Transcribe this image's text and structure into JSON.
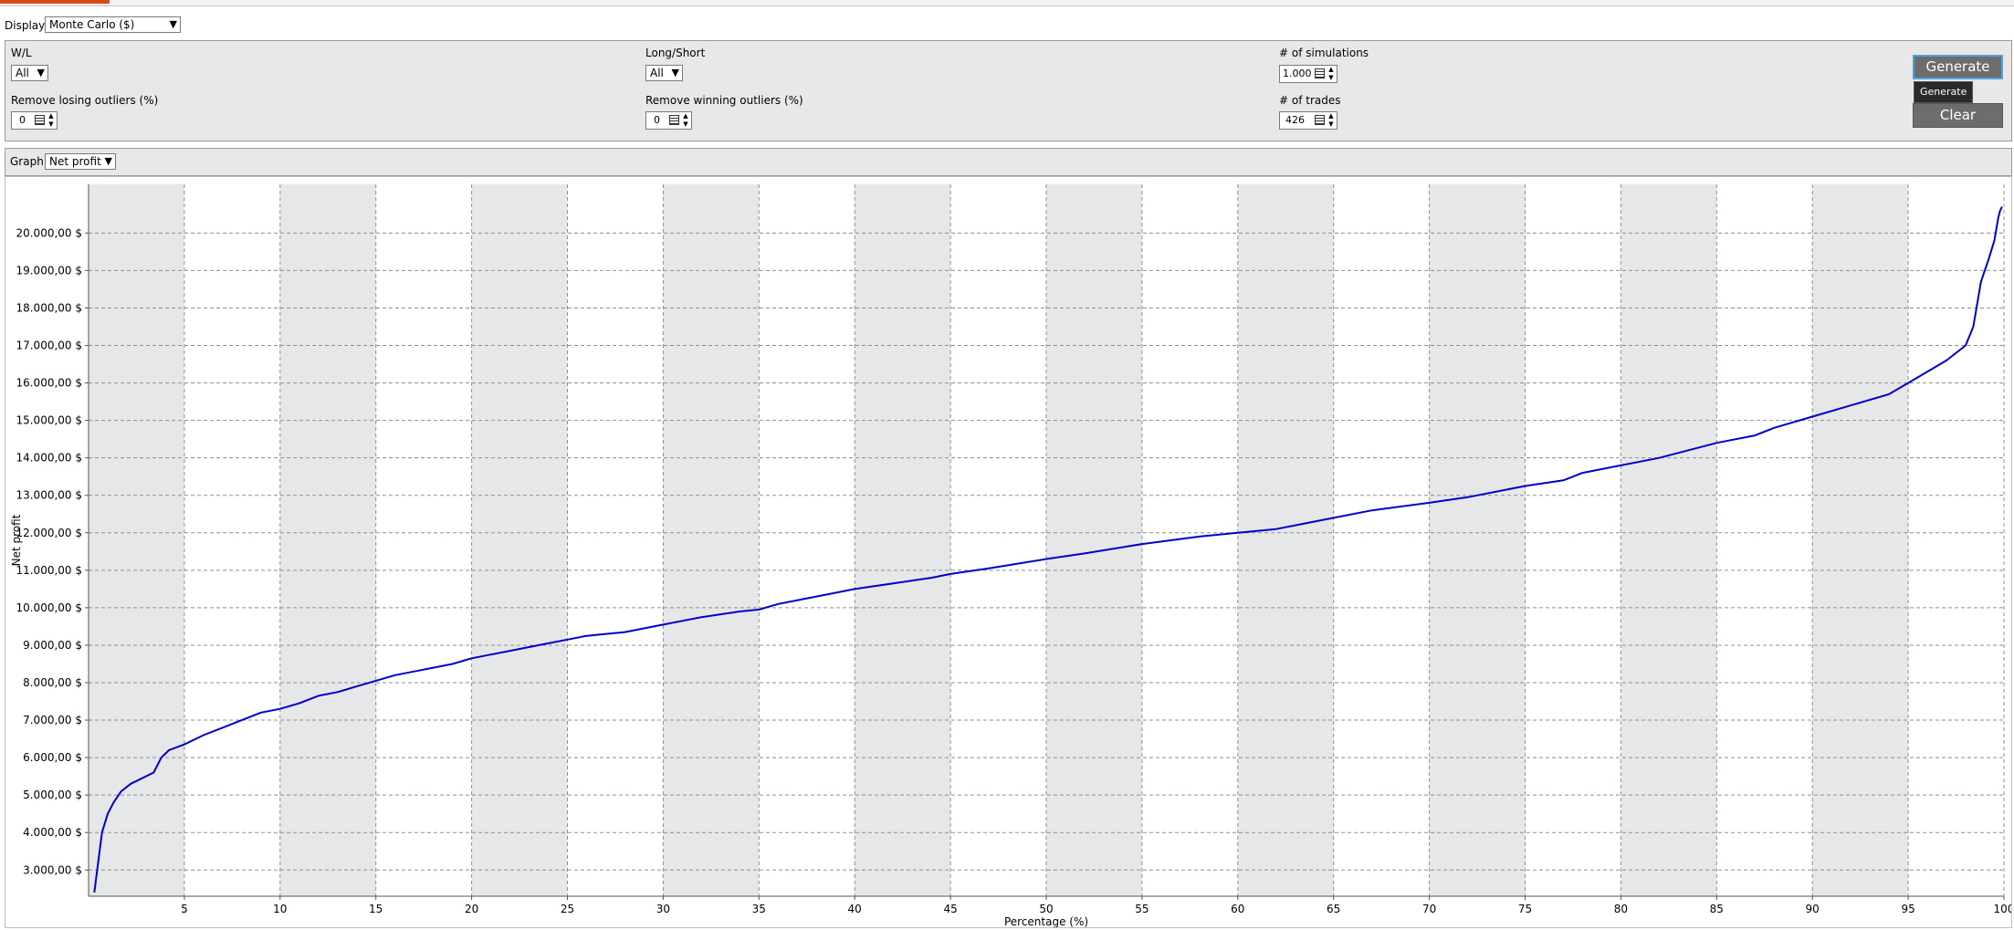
{
  "display": {
    "label": "Display",
    "value": "Monte Carlo ($)"
  },
  "filters": {
    "wl": {
      "label": "W/L",
      "value": "All"
    },
    "long_short": {
      "label": "Long/Short",
      "value": "All"
    },
    "simulations": {
      "label": "# of simulations",
      "value": "1.000"
    },
    "remove_losing": {
      "label": "Remove losing outliers (%)",
      "value": "0"
    },
    "remove_winning": {
      "label": "Remove winning outliers (%)",
      "value": "0"
    },
    "trades": {
      "label": "# of trades",
      "value": "426"
    }
  },
  "buttons": {
    "generate": "Generate",
    "generate_tooltip": "Generate",
    "clear": "Clear"
  },
  "graph": {
    "label": "Graph",
    "value": "Net profit"
  },
  "colors": {
    "line": "#0000cc",
    "band": "#e6e7e9",
    "panel": "#e8e8e8",
    "button": "#6d6d6d",
    "accent_tab": "#d84a1b"
  },
  "chart_data": {
    "type": "line",
    "title": "",
    "xlabel": "Percentage (%)",
    "ylabel": "Net profit",
    "xlim": [
      0,
      100
    ],
    "ylim": [
      2300,
      21300
    ],
    "grid": true,
    "x_ticks": [
      5,
      10,
      15,
      20,
      25,
      30,
      35,
      40,
      45,
      50,
      55,
      60,
      65,
      70,
      75,
      80,
      85,
      90,
      95,
      100
    ],
    "x_tick_labels": [
      "5",
      "10",
      "15",
      "20",
      "25",
      "30",
      "35",
      "40",
      "45",
      "50",
      "55",
      "60",
      "65",
      "70",
      "75",
      "80",
      "85",
      "90",
      "95",
      "100"
    ],
    "y_ticks": [
      3000,
      4000,
      5000,
      6000,
      7000,
      8000,
      9000,
      10000,
      11000,
      12000,
      13000,
      14000,
      15000,
      16000,
      17000,
      18000,
      19000,
      20000
    ],
    "y_tick_labels": [
      "3.000,00 $",
      "4.000,00 $",
      "5.000,00 $",
      "6.000,00 $",
      "7.000,00 $",
      "8.000,00 $",
      "9.000,00 $",
      "10.000,00 $",
      "11.000,00 $",
      "12.000,00 $",
      "13.000,00 $",
      "14.000,00 $",
      "15.000,00 $",
      "16.000,00 $",
      "17.000,00 $",
      "18.000,00 $",
      "19.000,00 $",
      "20.000,00 $"
    ],
    "series": [
      {
        "x": [
          0.3,
          0.5,
          0.7,
          1.0,
          1.3,
          1.7,
          2.2,
          2.8,
          3.4,
          3.8,
          4.0,
          4.2,
          5.0,
          6.0,
          7.0,
          8.0,
          9.0,
          10.0,
          11.0,
          12.0,
          13.0,
          14.0,
          15.0,
          16.0,
          17.0,
          18.0,
          19.0,
          20.0,
          21.0,
          22.0,
          23.0,
          24.0,
          25.0,
          26.0,
          27.0,
          28.0,
          29.0,
          30.0,
          32.0,
          34.0,
          35.0,
          36.0,
          38.0,
          40.0,
          42.0,
          44.0,
          45.0,
          47.0,
          50.0,
          52.0,
          55.0,
          58.0,
          60.0,
          62.0,
          63.0,
          65.0,
          67.0,
          70.0,
          72.0,
          75.0,
          77.0,
          78.0,
          80.0,
          82.0,
          85.0,
          87.0,
          88.0,
          90.0,
          92.0,
          94.0,
          95.0,
          96.0,
          97.0,
          98.0,
          98.4,
          98.8,
          99.0,
          99.2,
          99.5,
          99.7,
          99.8,
          99.9
        ],
        "y": [
          2400,
          3200,
          4000,
          4500,
          4800,
          5100,
          5300,
          5450,
          5600,
          6000,
          6100,
          6200,
          6350,
          6600,
          6800,
          7000,
          7200,
          7300,
          7450,
          7650,
          7750,
          7900,
          8050,
          8200,
          8300,
          8400,
          8500,
          8650,
          8750,
          8850,
          8950,
          9050,
          9150,
          9250,
          9300,
          9350,
          9450,
          9550,
          9750,
          9900,
          9950,
          10100,
          10300,
          10500,
          10650,
          10800,
          10900,
          11050,
          11300,
          11450,
          11700,
          11900,
          12000,
          12100,
          12200,
          12400,
          12600,
          12800,
          12950,
          13250,
          13400,
          13600,
          13800,
          14000,
          14400,
          14600,
          14800,
          15100,
          15400,
          15700,
          16000,
          16300,
          16600,
          17000,
          17500,
          18700,
          19000,
          19300,
          19800,
          20400,
          20600,
          20700
        ]
      }
    ]
  }
}
